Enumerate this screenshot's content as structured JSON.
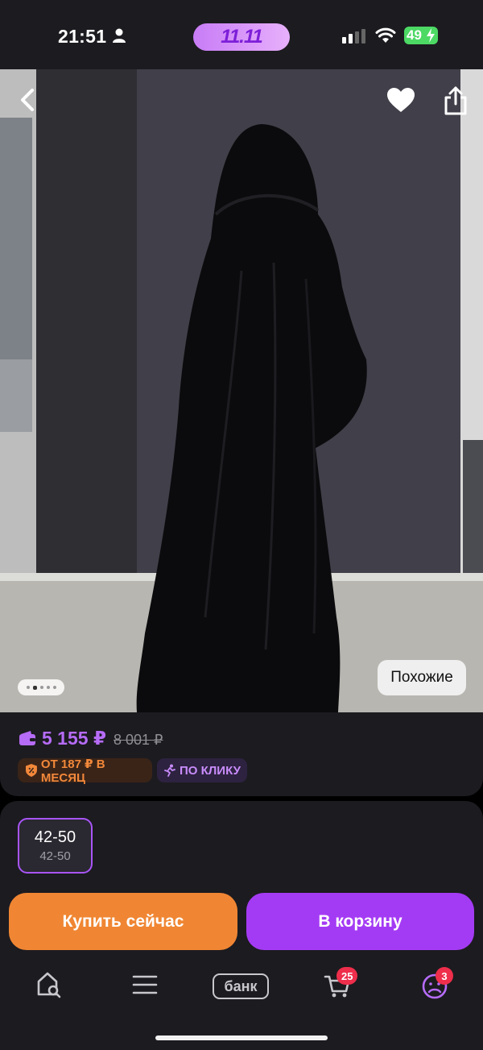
{
  "status_bar": {
    "time": "21:51",
    "promo": "11.11",
    "battery": "49"
  },
  "product": {
    "price": "5 155 ₽",
    "old_price": "8 001 ₽",
    "installment_badge": "ОТ 187 ₽ В МЕСЯЦ",
    "click_badge": "ПО КЛИКУ",
    "similar_label": "Похожие",
    "photo_count": 5,
    "photo_index": 2
  },
  "size": {
    "main": "42-50",
    "sub": "42-50"
  },
  "actions": {
    "buy_now": "Купить сейчас",
    "add_to_cart": "В корзину"
  },
  "tabbar": {
    "bank_label": "банк",
    "cart_count": "25",
    "profile_count": "3"
  },
  "colors": {
    "accent_purple": "#a43bf4",
    "accent_orange": "#f08633",
    "price_purple": "#b66cf7",
    "badge_red": "#ee2e4b"
  }
}
